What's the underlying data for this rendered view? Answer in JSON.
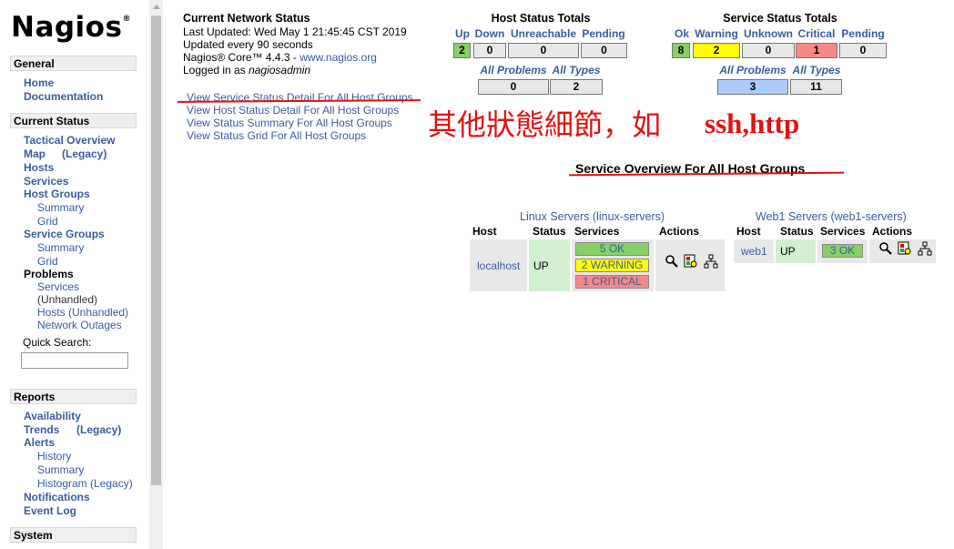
{
  "logo": {
    "text": "Nagios",
    "mark": "®"
  },
  "sidebar": {
    "general": {
      "title": "General",
      "items": [
        "Home",
        "Documentation"
      ]
    },
    "current_status": {
      "title": "Current Status",
      "tactical": "Tactical Overview",
      "map": "Map",
      "map_legacy": "(Legacy)",
      "hosts": "Hosts",
      "services": "Services",
      "host_groups": "Host Groups",
      "hg_summary": "Summary",
      "hg_grid": "Grid",
      "service_groups": "Service Groups",
      "sg_summary": "Summary",
      "sg_grid": "Grid",
      "problems": "Problems",
      "p_services": "Services",
      "p_unhandled": "(Unhandled)",
      "p_hosts": "Hosts (Unhandled)",
      "p_outages": "Network Outages",
      "quick_search": "Quick Search:"
    },
    "reports": {
      "title": "Reports",
      "availability": "Availability",
      "trends": "Trends",
      "trends_legacy": "(Legacy)",
      "alerts": "Alerts",
      "history": "History",
      "summary": "Summary",
      "histogram": "Histogram (Legacy)",
      "notifications": "Notifications",
      "event_log": "Event Log"
    },
    "system": {
      "title": "System"
    }
  },
  "status": {
    "title": "Current Network Status",
    "last_updated": "Last Updated: Wed May 1 21:45:45 CST 2019",
    "interval": "Updated every 90 seconds",
    "core_prefix": "Nagios® Core™ 4.4.3 - ",
    "core_link": "www.nagios.org",
    "logged_prefix": "Logged in as ",
    "user": "nagiosadmin",
    "links": [
      "View Service Status Detail For All Host Groups",
      "View Host Status Detail For All Host Groups",
      "View Status Summary For All Host Groups",
      "View Status Grid For All Host Groups"
    ]
  },
  "host_totals": {
    "title": "Host Status Totals",
    "headers": [
      "Up",
      "Down",
      "Unreachable",
      "Pending"
    ],
    "values": [
      "2",
      "0",
      "0",
      "0"
    ],
    "problem_headers": [
      "All Problems",
      "All Types"
    ],
    "problem_values": [
      "0",
      "2"
    ]
  },
  "service_totals": {
    "title": "Service Status Totals",
    "headers": [
      "Ok",
      "Warning",
      "Unknown",
      "Critical",
      "Pending"
    ],
    "values": [
      "8",
      "2",
      "0",
      "1",
      "0"
    ],
    "problem_headers": [
      "All Problems",
      "All Types"
    ],
    "problem_values": [
      "3",
      "11"
    ]
  },
  "annotation": {
    "chinese": "其他狀態細節，如",
    "english": "ssh,http",
    "color": "#e31212"
  },
  "overview": {
    "title": "Service Overview For All Host Groups"
  },
  "hostgroups": [
    {
      "name": "Linux Servers",
      "alias": "(linux-servers)",
      "headers": [
        "Host",
        "Status",
        "Services",
        "Actions"
      ],
      "host": "localhost",
      "status": "UP",
      "services": [
        "5 OK",
        "2 WARNING",
        "1 CRITICAL"
      ]
    },
    {
      "name": "Web1 Servers",
      "alias": "(web1-servers)",
      "headers": [
        "Host",
        "Status",
        "Services",
        "Actions"
      ],
      "host": "web1",
      "status": "UP",
      "services": [
        "3 OK"
      ]
    }
  ],
  "colors": {
    "ok": "#88d066",
    "warning": "#ffff00",
    "critical": "#f88888",
    "up": "#d0f0d0",
    "problems": "#aaccff"
  }
}
